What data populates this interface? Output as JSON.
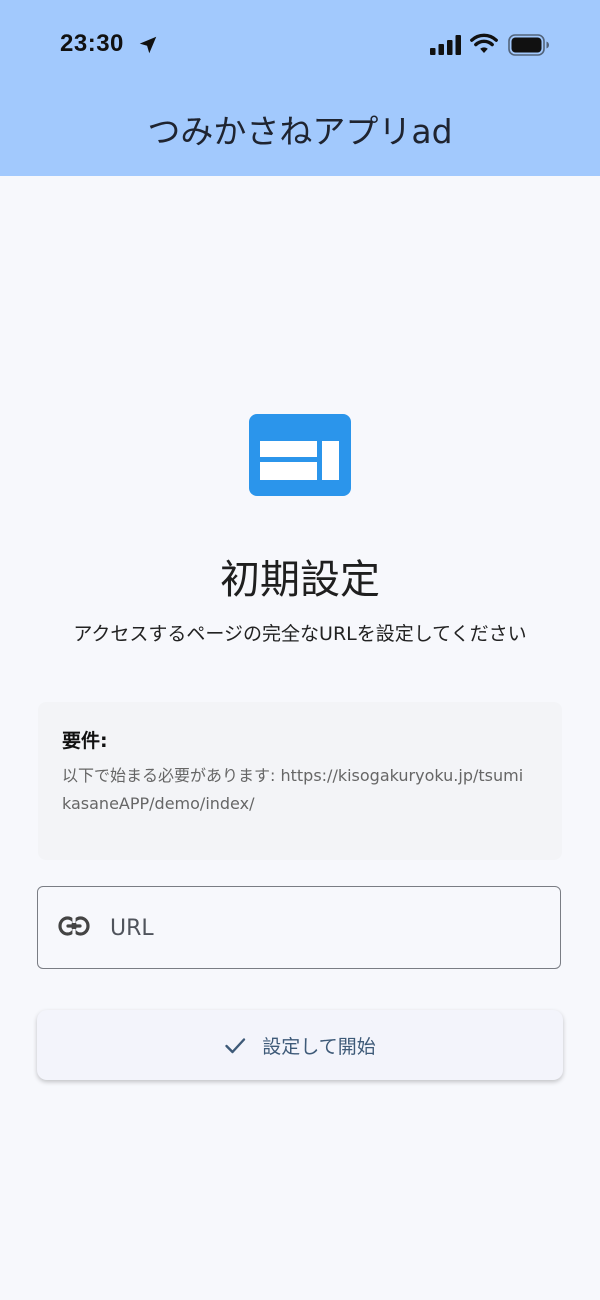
{
  "status_bar": {
    "time": "23:30",
    "location_icon": "location-arrow-icon",
    "signal_icon": "cellular-signal-icon",
    "wifi_icon": "wifi-icon",
    "battery_icon": "battery-icon"
  },
  "app_bar": {
    "title": "つみかさねアプリad",
    "background_color": "#a2c9fd"
  },
  "setup": {
    "icon": "web-page-icon",
    "icon_color": "#2b95eb",
    "title": "初期設定",
    "subtitle": "アクセスするページの完全なURLを設定してください"
  },
  "requirements": {
    "heading": "要件:",
    "text": "以下で始まる必要があります: https://kisogakuryoku.jp/tsumikasaneAPP/demo/index/"
  },
  "url_field": {
    "icon": "link-icon",
    "placeholder": "URL",
    "value": ""
  },
  "start_button": {
    "icon": "check-icon",
    "label": "設定して開始"
  }
}
